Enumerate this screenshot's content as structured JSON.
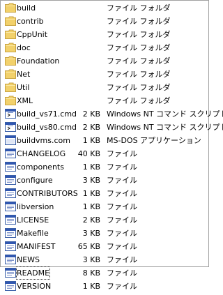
{
  "files": [
    {
      "name": "build",
      "size": "",
      "type": "ファイル フォルダ",
      "icon": "folder-icon"
    },
    {
      "name": "contrib",
      "size": "",
      "type": "ファイル フォルダ",
      "icon": "folder-icon"
    },
    {
      "name": "CppUnit",
      "size": "",
      "type": "ファイル フォルダ",
      "icon": "folder-icon"
    },
    {
      "name": "doc",
      "size": "",
      "type": "ファイル フォルダ",
      "icon": "folder-icon"
    },
    {
      "name": "Foundation",
      "size": "",
      "type": "ファイル フォルダ",
      "icon": "folder-icon"
    },
    {
      "name": "Net",
      "size": "",
      "type": "ファイル フォルダ",
      "icon": "folder-icon"
    },
    {
      "name": "Util",
      "size": "",
      "type": "ファイル フォルダ",
      "icon": "folder-icon"
    },
    {
      "name": "XML",
      "size": "",
      "type": "ファイル フォルダ",
      "icon": "folder-icon"
    },
    {
      "name": "build_vs71.cmd",
      "size": "2 KB",
      "type": "Windows NT コマンド スクリプト",
      "icon": "command-script-icon"
    },
    {
      "name": "build_vs80.cmd",
      "size": "2 KB",
      "type": "Windows NT コマンド スクリプト",
      "icon": "command-script-icon"
    },
    {
      "name": "buildvms.com",
      "size": "1 KB",
      "type": "MS-DOS アプリケーション",
      "icon": "msdos-application-icon"
    },
    {
      "name": "CHANGELOG",
      "size": "40 KB",
      "type": "ファイル",
      "icon": "file-icon"
    },
    {
      "name": "components",
      "size": "1 KB",
      "type": "ファイル",
      "icon": "file-icon"
    },
    {
      "name": "configure",
      "size": "3 KB",
      "type": "ファイル",
      "icon": "file-icon"
    },
    {
      "name": "CONTRIBUTORS",
      "size": "1 KB",
      "type": "ファイル",
      "icon": "file-icon"
    },
    {
      "name": "libversion",
      "size": "1 KB",
      "type": "ファイル",
      "icon": "file-icon"
    },
    {
      "name": "LICENSE",
      "size": "2 KB",
      "type": "ファイル",
      "icon": "file-icon"
    },
    {
      "name": "Makefile",
      "size": "3 KB",
      "type": "ファイル",
      "icon": "file-icon"
    },
    {
      "name": "MANIFEST",
      "size": "65 KB",
      "type": "ファイル",
      "icon": "file-icon"
    },
    {
      "name": "NEWS",
      "size": "3 KB",
      "type": "ファイル",
      "icon": "file-icon"
    },
    {
      "name": "README",
      "size": "8 KB",
      "type": "ファイル",
      "icon": "file-icon",
      "focused": true
    },
    {
      "name": "VERSION",
      "size": "1 KB",
      "type": "ファイル",
      "icon": "file-icon"
    }
  ],
  "colors": {
    "folder_fill": "#f2d16b",
    "folder_dark": "#c9a441",
    "window_frame": "#3a5fa8",
    "window_title": "#2f56b0",
    "border": "#a0a0a0"
  }
}
